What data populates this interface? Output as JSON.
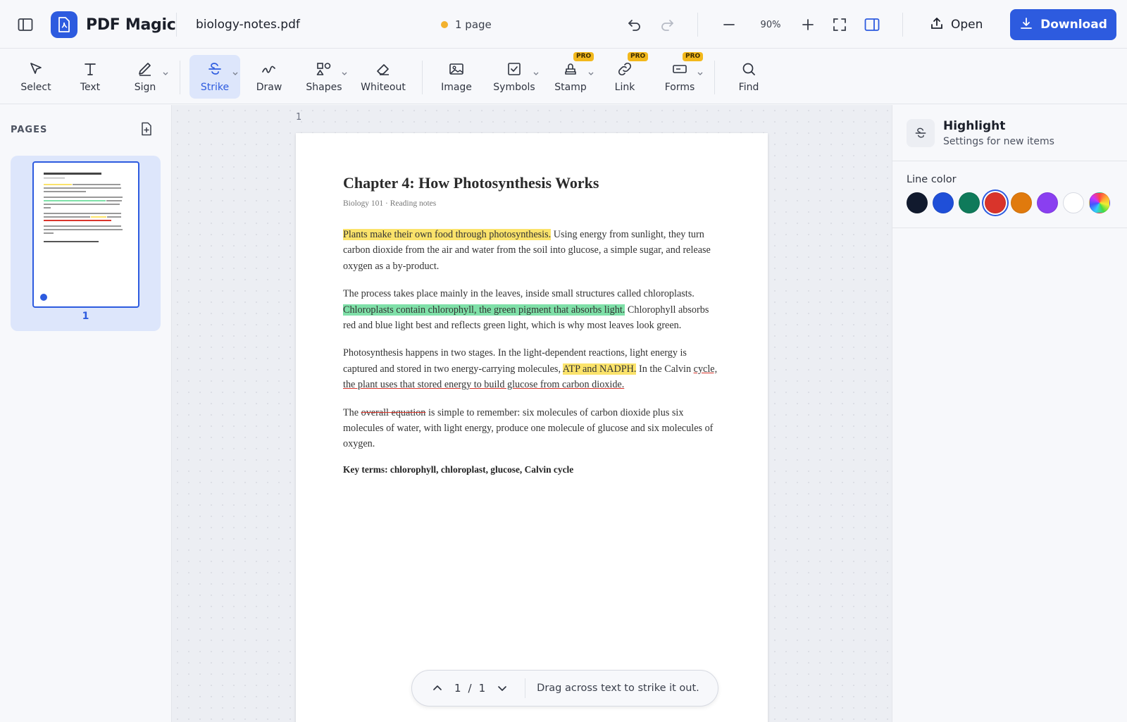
{
  "header": {
    "app_name": "PDF Magic",
    "file_name": "biology-notes.pdf",
    "page_count": "1 page",
    "zoom": "90%",
    "open_label": "Open",
    "download_label": "Download"
  },
  "toolbar": {
    "tools": [
      {
        "label": "Select",
        "icon": "cursor-icon"
      },
      {
        "label": "Text",
        "icon": "text-icon"
      },
      {
        "label": "Sign",
        "icon": "pen-icon"
      },
      {
        "label": "Strike",
        "icon": "strikethrough-icon",
        "active": true
      },
      {
        "label": "Draw",
        "icon": "squiggle-icon"
      },
      {
        "label": "Shapes",
        "icon": "shapes-icon"
      },
      {
        "label": "Whiteout",
        "icon": "eraser-icon"
      },
      {
        "label": "Image",
        "icon": "image-icon"
      },
      {
        "label": "Symbols",
        "icon": "checkbox-icon"
      },
      {
        "label": "Stamp",
        "icon": "stamp-icon",
        "badge": "PRO"
      },
      {
        "label": "Link",
        "icon": "link-icon",
        "badge": "PRO"
      },
      {
        "label": "Forms",
        "icon": "forms-icon",
        "badge": "PRO"
      },
      {
        "label": "Find",
        "icon": "search-icon"
      }
    ]
  },
  "pages_panel": {
    "title": "PAGES",
    "thumbnail_number": "1"
  },
  "canvas": {
    "page_label": "1",
    "document": {
      "title": "Chapter 4: How Photosynthesis Works",
      "subtitle": "Biology 101  ·  Reading notes",
      "p1_highlight": "Plants make their own food through photosynthesis.",
      "p1_rest": " Using energy from sunlight, they turn carbon dioxide from the air and water from the soil into glucose, a simple sugar, and release oxygen as a by-product.",
      "p2_start": "The process takes place mainly in the leaves, inside small structures called chloroplasts. ",
      "p2_highlight": "Chloroplasts contain chlorophyll, the green pigment that absorbs light.",
      "p2_rest": " Chlorophyll absorbs red and blue light best and reflects green light, which is why most leaves look green.",
      "p3_start": "Photosynthesis happens in two stages. In the light-dependent reactions, light energy is captured and stored in two energy-carrying molecules, ",
      "p3_highlight": "ATP and NADPH.",
      "p3_mid": " In the Calvin ",
      "p3_underline": "cycle, the plant uses that stored energy to build glucose from carbon dioxide.",
      "p4_start": "The ",
      "p4_strike": "overall equation",
      "p4_rest": " is simple to remember: six molecules of carbon dioxide plus six molecules of water, with light energy, produce one molecule of glucose and six molecules of oxygen.",
      "key_terms": "Key terms: chlorophyll, chloroplast, glucose, Calvin cycle"
    }
  },
  "page_nav": {
    "current": "1",
    "separator": "/",
    "total": "1",
    "hint": "Drag across text to strike it out."
  },
  "right_panel": {
    "title": "Highlight",
    "subtitle": "Settings for new items",
    "line_color_label": "Line color",
    "colors": [
      "#111a2e",
      "#1f4fd8",
      "#0f7a5a",
      "#d9342b",
      "#e07a0d",
      "#8a3ff0",
      "#ffffff",
      "rainbow"
    ],
    "selected_color": "#d9342b"
  }
}
